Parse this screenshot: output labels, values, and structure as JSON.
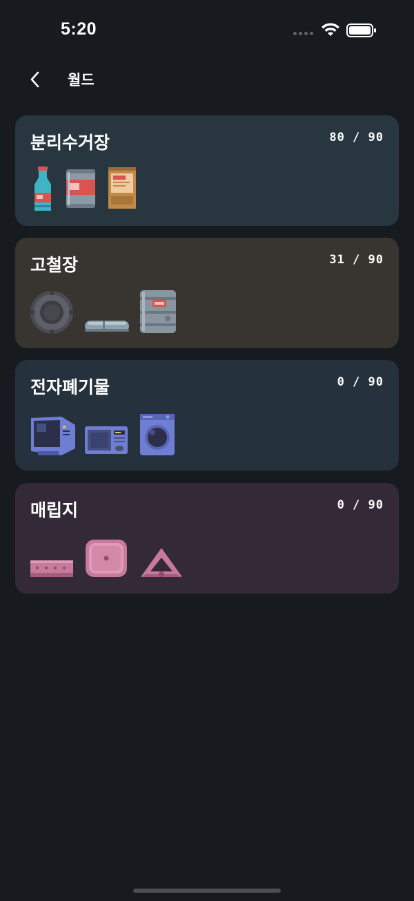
{
  "status_bar": {
    "time": "5:20"
  },
  "nav": {
    "title": "월드",
    "back_icon": "chevron-left-icon"
  },
  "worlds": [
    {
      "id": "recycling",
      "name": "분리수거장",
      "count": "80 / 90",
      "bg_color": "#283640",
      "items": [
        "bottle-icon",
        "can-icon",
        "carton-icon"
      ]
    },
    {
      "id": "scrapyard",
      "name": "고철장",
      "count": "31 / 90",
      "bg_color": "#38342f",
      "items": [
        "tire-icon",
        "pipe-icon",
        "barrel-icon"
      ]
    },
    {
      "id": "e-waste",
      "name": "전자폐기물",
      "count": "0 / 90",
      "bg_color": "#25313d",
      "items": [
        "monitor-icon",
        "microwave-icon",
        "washing-machine-icon"
      ]
    },
    {
      "id": "landfill",
      "name": "매립지",
      "count": "0 / 90",
      "bg_color": "#342a37",
      "items": [
        "plank-icon",
        "container-icon",
        "triangle-icon"
      ]
    }
  ]
}
